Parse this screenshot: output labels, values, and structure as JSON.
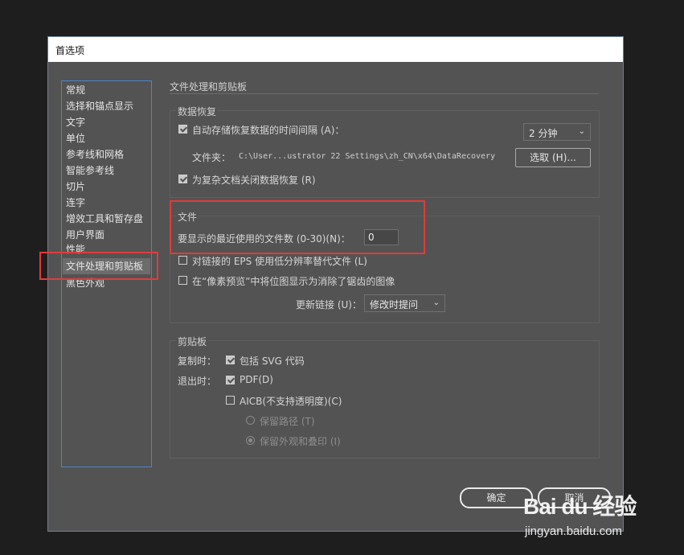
{
  "dialog": {
    "title": "首选项"
  },
  "sidebar": {
    "items": [
      {
        "label": "常规"
      },
      {
        "label": "选择和锚点显示"
      },
      {
        "label": "文字"
      },
      {
        "label": "单位"
      },
      {
        "label": "参考线和网格"
      },
      {
        "label": "智能参考线"
      },
      {
        "label": "切片"
      },
      {
        "label": "连字"
      },
      {
        "label": "增效工具和暂存盘"
      },
      {
        "label": "用户界面"
      },
      {
        "label": "性能"
      },
      {
        "label": "文件处理和剪贴板"
      },
      {
        "label": "黑色外观"
      }
    ],
    "selected": "文件处理和剪贴板"
  },
  "main": {
    "section_title": "文件处理和剪贴板",
    "data_recovery": {
      "legend": "数据恢复",
      "autosave_label": "自动存储恢复数据的时间间隔 (A)：",
      "autosave_checked": true,
      "interval_value": "2 分钟",
      "folder_label": "文件夹：",
      "folder_path": "C:\\User...ustrator 22 Settings\\zh_CN\\x64\\DataRecovery",
      "choose_button": "选取 (H)...",
      "complex_label": "为复杂文档关闭数据恢复 (R)",
      "complex_checked": true
    },
    "files": {
      "legend": "文件",
      "recent_label": "要显示的最近使用的文件数 (0-30)(N)：",
      "recent_value": "0",
      "eps_label": "对链接的 EPS 使用低分辨率替代文件 (L)",
      "eps_checked": false,
      "pixel_label": "在“像素预览”中将位图显示为消除了锯齿的图像",
      "pixel_checked": false,
      "update_label": "更新链接 (U)：",
      "update_value": "修改时提问"
    },
    "clipboard": {
      "legend": "剪贴板",
      "copy_label": "复制时：",
      "svg_label": "包括 SVG 代码",
      "svg_checked": true,
      "exit_label": "退出时：",
      "pdf_label": "PDF(D)",
      "pdf_checked": true,
      "aicb_label": "AICB(不支持透明度)(C)",
      "aicb_checked": false,
      "keep_path_label": "保留路径 (T)",
      "keep_appearance_label": "保留外观和叠印 (I)"
    }
  },
  "footer": {
    "ok_label": "确定",
    "cancel_label": "取消"
  },
  "watermark": {
    "brand": "Bai du 经验",
    "url": "jingyan.baidu.com"
  },
  "colors": {
    "highlight": "#e23b3b",
    "panel": "#535353",
    "selection_border": "#4b86c8"
  }
}
